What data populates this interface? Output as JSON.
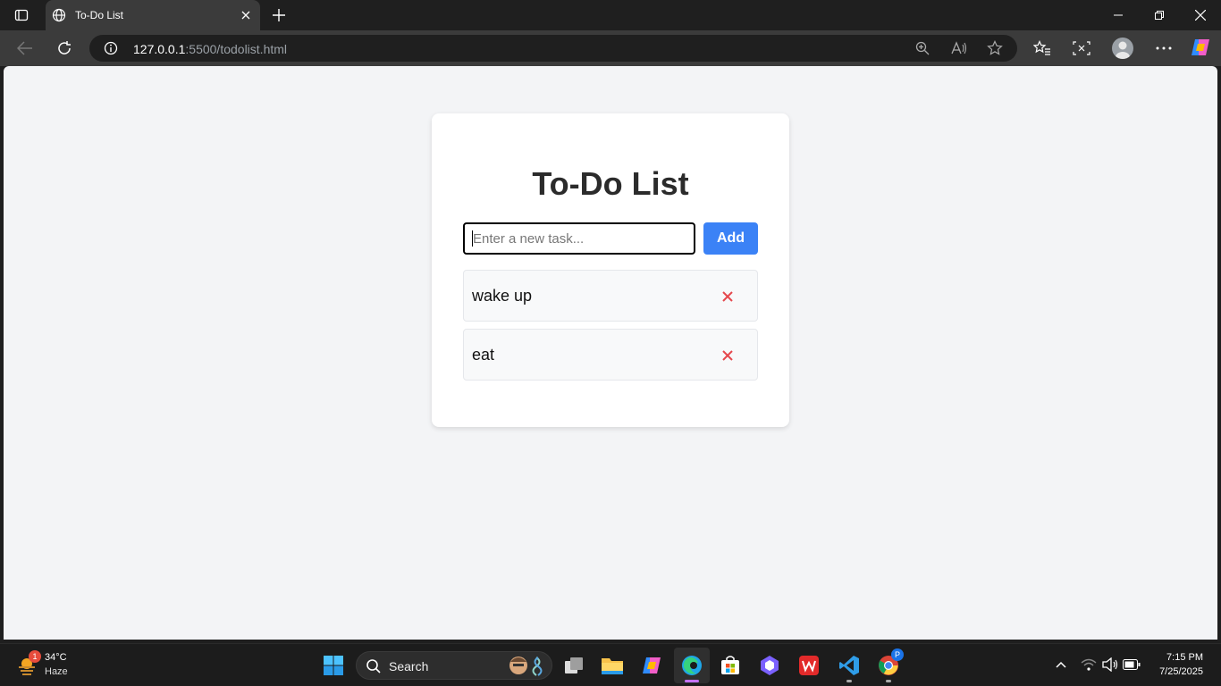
{
  "browser": {
    "tab_title": "To-Do List",
    "url_host": "127.0.0.1",
    "url_rest": ":5500/todolist.html"
  },
  "page": {
    "heading": "To-Do List",
    "input_placeholder": "Enter a new task...",
    "input_value": "",
    "add_label": "Add",
    "tasks": [
      {
        "text": "wake up",
        "delete_glyph": "✕"
      },
      {
        "text": "eat",
        "delete_glyph": "✕"
      }
    ]
  },
  "colors": {
    "accent": "#3b82f6",
    "delete": "#e5484d",
    "page_bg": "#f3f4f6"
  },
  "taskbar": {
    "weather_temp": "34°C",
    "weather_desc": "Haze",
    "weather_badge": "1",
    "search_label": "Search",
    "time": "7:15 PM",
    "date": "7/25/2025",
    "chrome_badge": "P"
  }
}
